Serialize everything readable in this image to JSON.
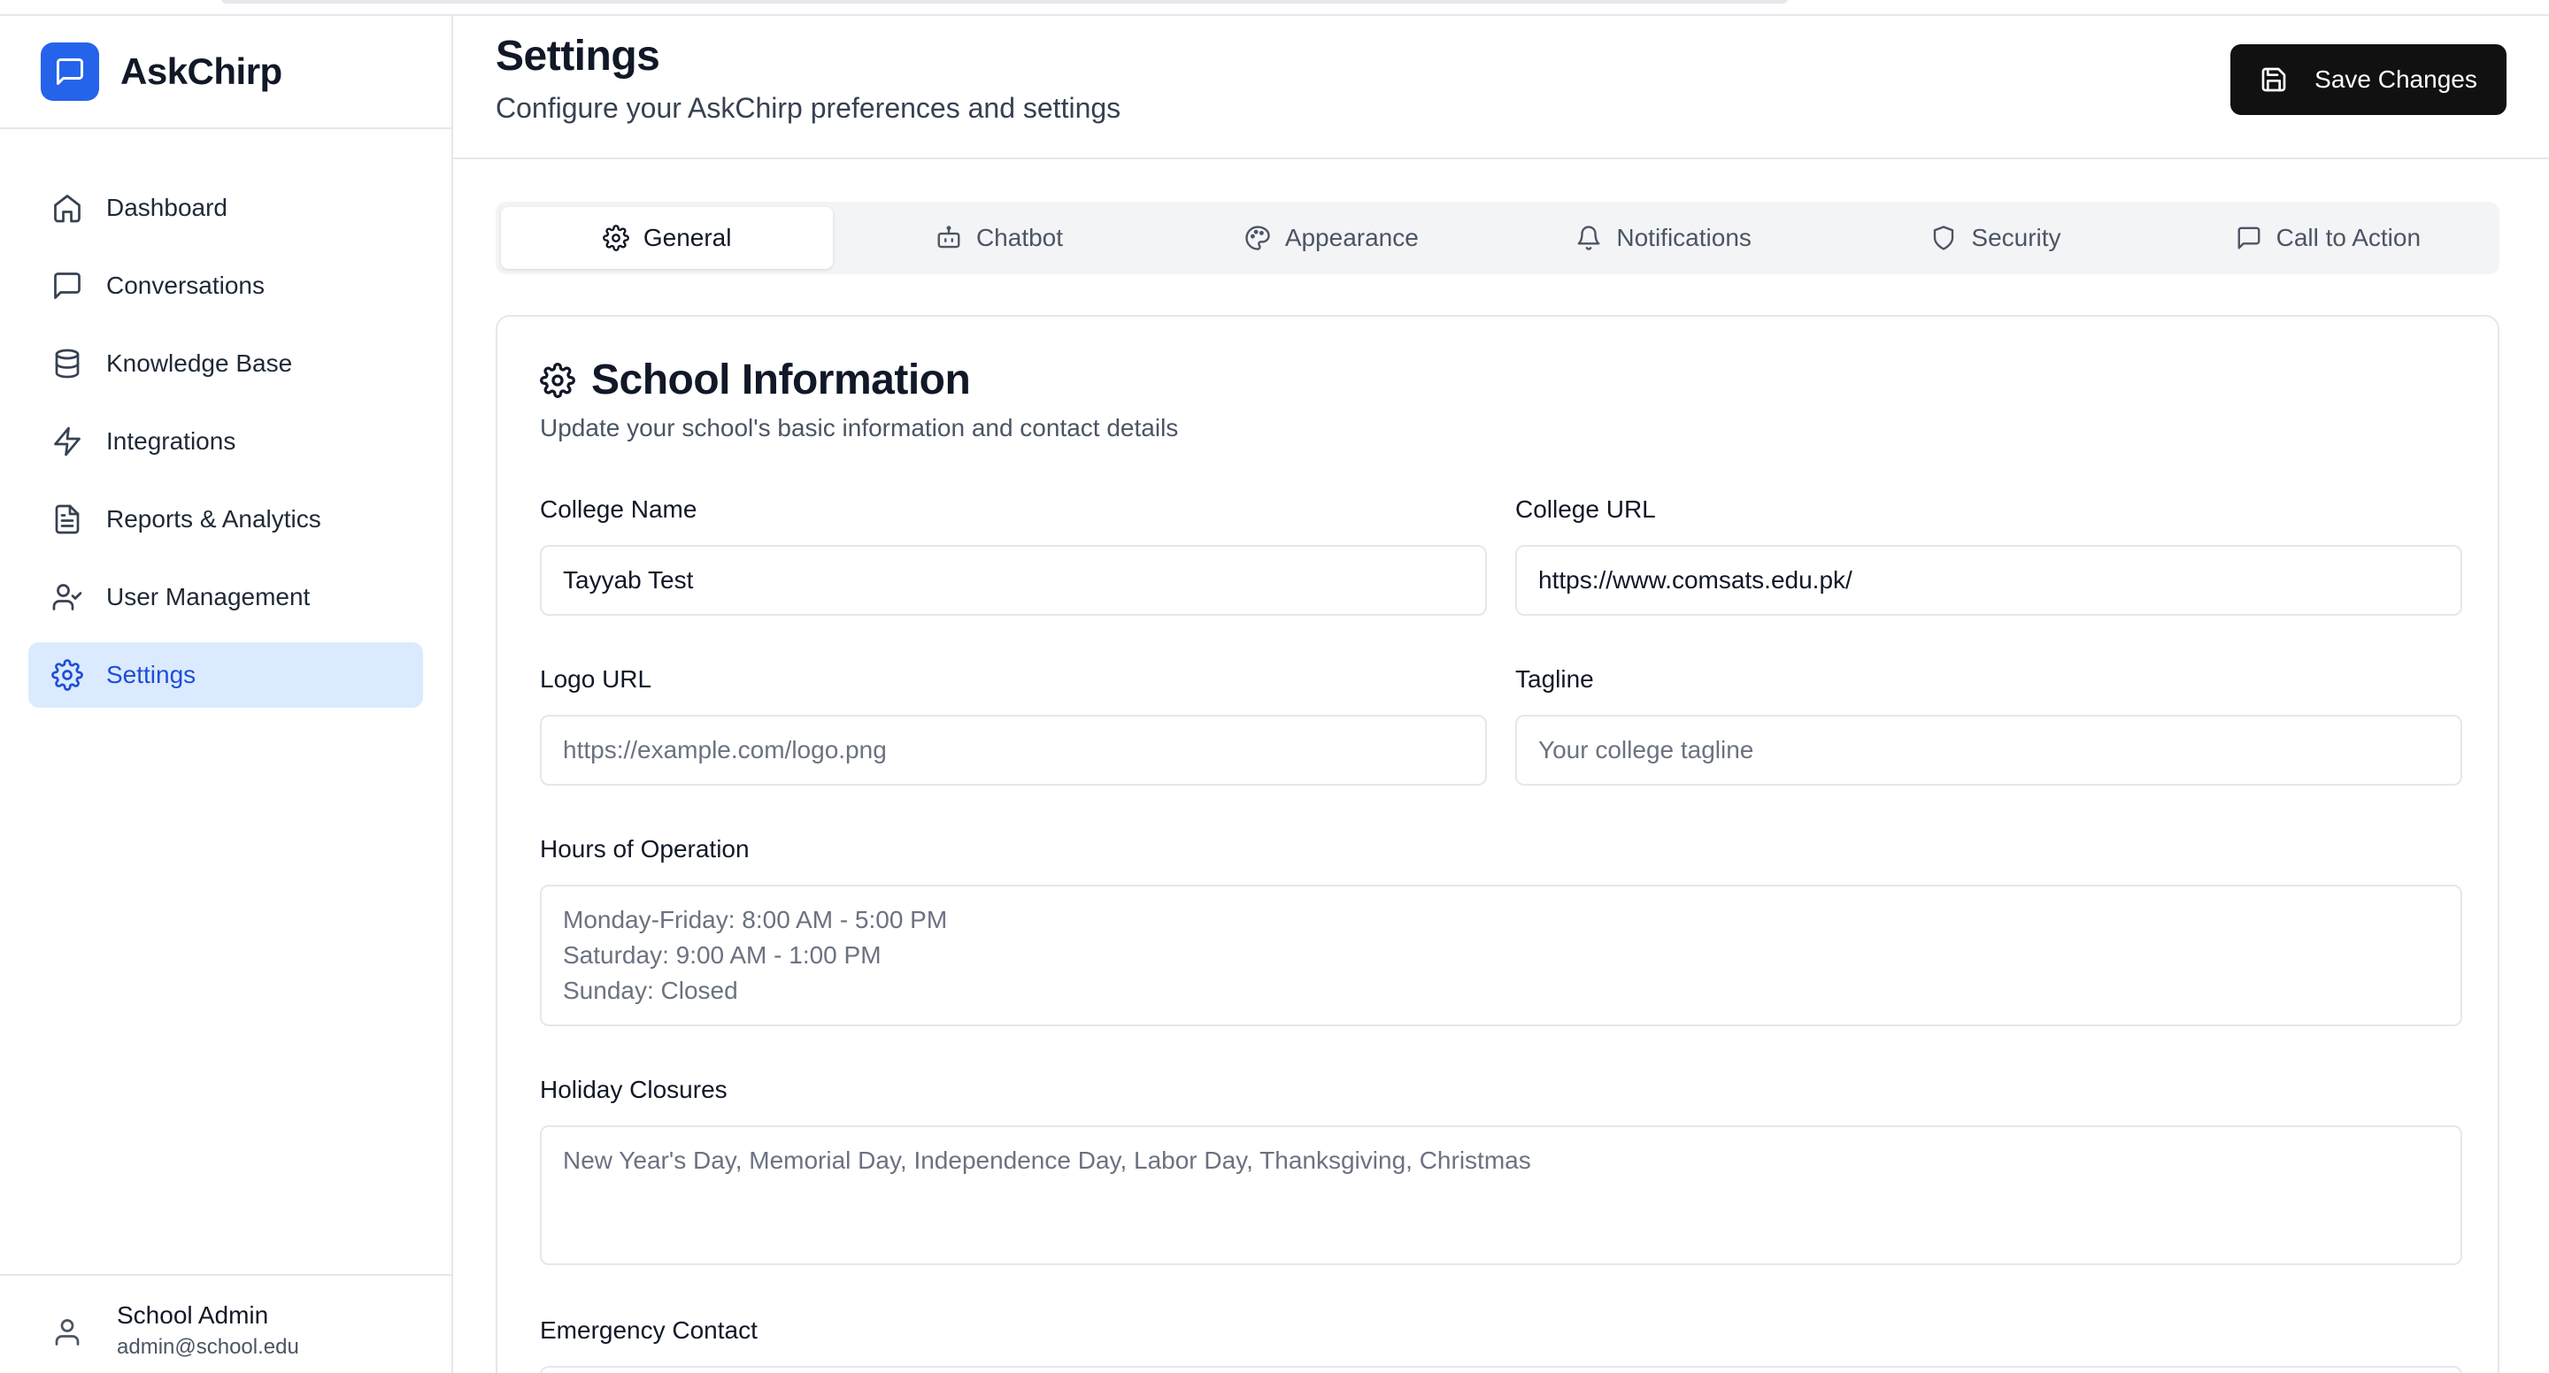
{
  "brand": {
    "name": "AskChirp"
  },
  "sidebar": {
    "items": [
      {
        "label": "Dashboard",
        "icon": "home-icon"
      },
      {
        "label": "Conversations",
        "icon": "message-square-icon"
      },
      {
        "label": "Knowledge Base",
        "icon": "database-icon"
      },
      {
        "label": "Integrations",
        "icon": "zap-icon"
      },
      {
        "label": "Reports & Analytics",
        "icon": "file-text-icon"
      },
      {
        "label": "User Management",
        "icon": "user-check-icon"
      },
      {
        "label": "Settings",
        "icon": "gear-icon",
        "active": true
      }
    ],
    "user": {
      "name": "School Admin",
      "email": "admin@school.edu"
    }
  },
  "header": {
    "title": "Settings",
    "subtitle": "Configure your AskChirp preferences and settings",
    "save_label": "Save Changes"
  },
  "tabs": [
    {
      "label": "General",
      "icon": "gear-icon",
      "active": true
    },
    {
      "label": "Chatbot",
      "icon": "bot-icon"
    },
    {
      "label": "Appearance",
      "icon": "palette-icon"
    },
    {
      "label": "Notifications",
      "icon": "bell-icon"
    },
    {
      "label": "Security",
      "icon": "shield-icon"
    },
    {
      "label": "Call to Action",
      "icon": "message-square-icon"
    }
  ],
  "card": {
    "title": "School Information",
    "description": "Update your school's basic information and contact details",
    "fields": {
      "college_name": {
        "label": "College Name",
        "value": "Tayyab Test"
      },
      "college_url": {
        "label": "College URL",
        "value": "https://www.comsats.edu.pk/"
      },
      "logo_url": {
        "label": "Logo URL",
        "placeholder": "https://example.com/logo.png"
      },
      "tagline": {
        "label": "Tagline",
        "placeholder": "Your college tagline"
      },
      "hours": {
        "label": "Hours of Operation",
        "placeholder_lines": [
          "Monday-Friday: 8:00 AM - 5:00 PM",
          "Saturday: 9:00 AM - 1:00 PM",
          "Sunday: Closed"
        ]
      },
      "holidays": {
        "label": "Holiday Closures",
        "placeholder": "New Year's Day, Memorial Day, Independence Day, Labor Day, Thanksgiving, Christmas"
      },
      "emergency": {
        "label": "Emergency Contact"
      }
    }
  },
  "colors": {
    "accent": "#2563eb",
    "active_bg": "#dbeafe",
    "active_text": "#1d4ed8",
    "primary_button": "#111111"
  }
}
